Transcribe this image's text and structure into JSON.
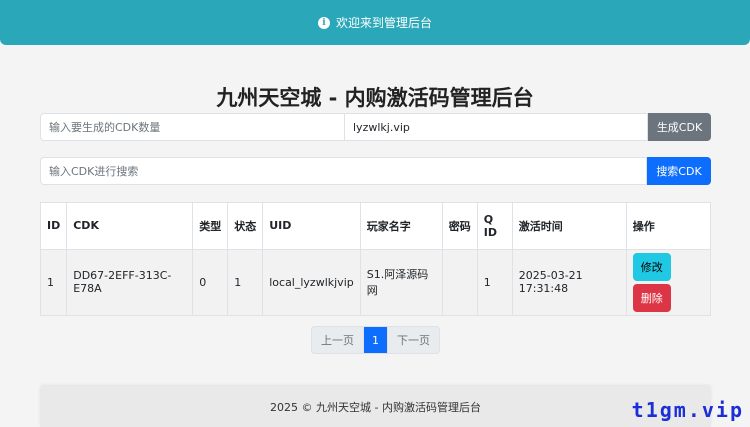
{
  "banner": {
    "icon": "info-icon",
    "text": "欢迎来到管理后台"
  },
  "page": {
    "title": "九州天空城 - 内购激活码管理后台"
  },
  "generate": {
    "count_placeholder": "输入要生成的CDK数量",
    "domain_value": "lyzwlkj.vip",
    "button": "生成CDK"
  },
  "search": {
    "placeholder": "输入CDK进行搜索",
    "button": "搜索CDK"
  },
  "table": {
    "headers": [
      "ID",
      "CDK",
      "类型",
      "状态",
      "UID",
      "玩家名字",
      "密码",
      "Q ID",
      "激活时间",
      "操作"
    ],
    "rows": [
      {
        "id": "1",
        "cdk": "DD67-2EFF-313C-E78A",
        "type": "0",
        "status": "1",
        "uid": "local_lyzwlkjvip",
        "player": "S1.阿泽源码网",
        "password": "",
        "qid": "1",
        "time": "2025-03-21 17:31:48",
        "edit": "修改",
        "delete": "删除"
      }
    ]
  },
  "pagination": {
    "prev": "上一页",
    "current": "1",
    "next": "下一页"
  },
  "footer": {
    "text": "2025 © 九州天空城 - 内购激活码管理后台"
  },
  "watermark": "t1gm.vip",
  "colors": {
    "banner": "#2aa7b8",
    "primary": "#0d6efd",
    "secondary": "#6c757d",
    "danger": "#dc3545",
    "info": "#1fc8e3"
  }
}
